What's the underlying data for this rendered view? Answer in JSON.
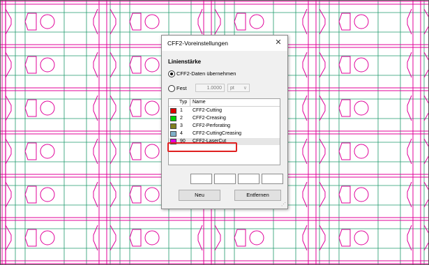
{
  "dialog": {
    "title": "CFF2-Voreinstellungen",
    "section_label": "Linienstärke",
    "option_take_label": "CFF2-Daten übernehmen",
    "option_fixed_label": "Fest",
    "fixed_value": "1.0000",
    "unit": "pt",
    "list_header": {
      "type": "Typ",
      "name": "Name"
    },
    "list_rows": [
      {
        "type": "1",
        "name": "CFF2-Cutting",
        "color": "#e00000"
      },
      {
        "type": "2",
        "name": "CFF2-Creasing",
        "color": "#00d000"
      },
      {
        "type": "3",
        "name": "CFF2-Perforating",
        "color": "#808020"
      },
      {
        "type": "4",
        "name": "CFF2-CuttingCreasing",
        "color": "#7fb0c8"
      },
      {
        "type": "90",
        "name": "CFF2-LaserCut",
        "color": "#e000e0"
      }
    ],
    "button_new": "Neu",
    "button_remove": "Entfernen"
  },
  "colors": {
    "cut_line": "#e0009a",
    "crease_line": "#1f9a6b",
    "highlight": "#e02020"
  }
}
